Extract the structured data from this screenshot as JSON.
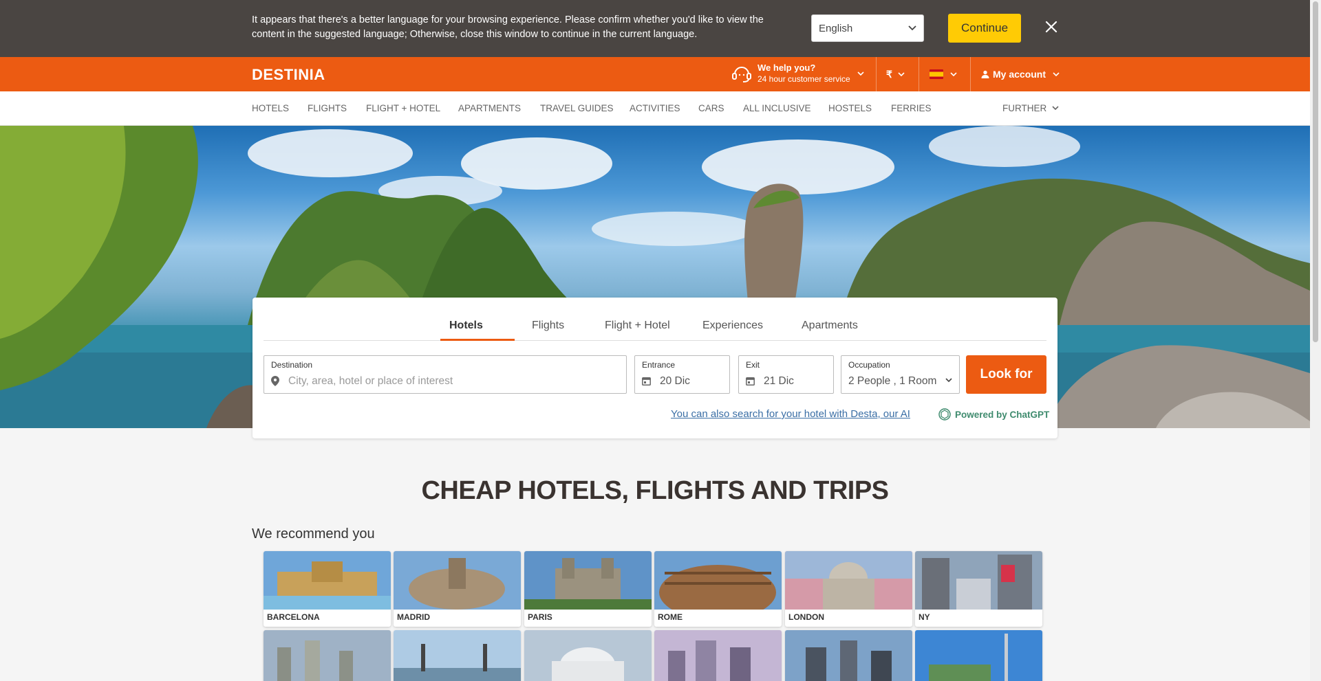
{
  "language_banner": {
    "message": "It appears that there's a better language for your browsing experience. Please confirm whether you'd like to view the content in the suggested language; Otherwise, close this window to continue in the current language.",
    "selected_language": "English",
    "continue_label": "Continue"
  },
  "header": {
    "logo": "DESTINIA",
    "help_title": "We help you?",
    "help_subtitle": "24 hour customer service",
    "currency": "₹",
    "account_label": "My account"
  },
  "nav": {
    "items": [
      "HOTELS",
      "FLIGHTS",
      "FLIGHT + HOTEL",
      "APARTMENTS",
      "TRAVEL GUIDES",
      "ACTIVITIES",
      "CARS",
      "ALL INCLUSIVE",
      "HOSTELS",
      "FERRIES"
    ],
    "further_label": "FURTHER"
  },
  "search": {
    "tabs": [
      "Hotels",
      "Flights",
      "Flight + Hotel",
      "Experiences",
      "Apartments"
    ],
    "active_tab": "Hotels",
    "destination_label": "Destination",
    "destination_placeholder": "City, area, hotel or place of interest",
    "entrance_label": "Entrance",
    "entrance_value": "20 Dic",
    "exit_label": "Exit",
    "exit_value": "21 Dic",
    "occupation_label": "Occupation",
    "occupation_value": "2 People , 1 Room",
    "search_button": "Look for",
    "desta_link": "You can also search for your hotel with Desta, our AI",
    "powered_by": "Powered by ChatGPT"
  },
  "main": {
    "title": "CHEAP HOTELS, FLIGHTS AND TRIPS",
    "recommend_heading": "We recommend you",
    "destinations": [
      "BARCELONA",
      "MADRID",
      "PARIS",
      "ROME",
      "LONDON",
      "NY"
    ]
  },
  "colors": {
    "brand_orange": "#ec5b12",
    "banner_bg": "#4a4542",
    "continue_yellow": "#ffcb05",
    "link_blue": "#3a6ea5",
    "chatgpt_green": "#3f8b6e"
  }
}
